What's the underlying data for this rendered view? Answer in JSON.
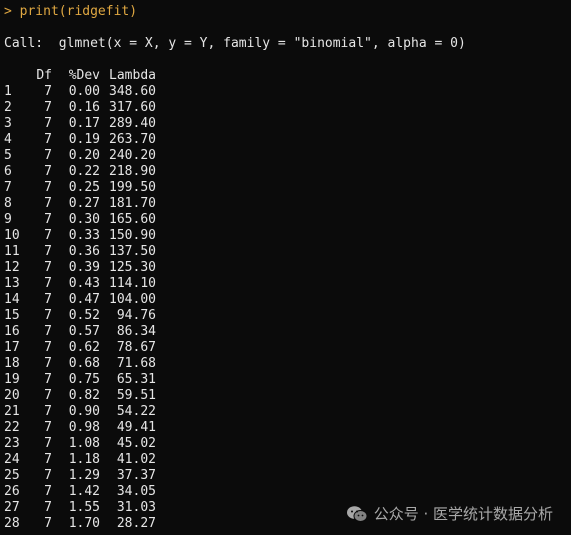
{
  "console": {
    "prompt_symbol": ">",
    "command": "print(ridgefit)",
    "call_line": "Call:  glmnet(x = X, y = Y, family = \"binomial\", alpha = 0)",
    "columns": [
      "",
      "Df",
      "%Dev",
      "Lambda"
    ],
    "rows": [
      {
        "idx": "1",
        "df": "7",
        "dev": "0.00",
        "lambda": "348.60"
      },
      {
        "idx": "2",
        "df": "7",
        "dev": "0.16",
        "lambda": "317.60"
      },
      {
        "idx": "3",
        "df": "7",
        "dev": "0.17",
        "lambda": "289.40"
      },
      {
        "idx": "4",
        "df": "7",
        "dev": "0.19",
        "lambda": "263.70"
      },
      {
        "idx": "5",
        "df": "7",
        "dev": "0.20",
        "lambda": "240.20"
      },
      {
        "idx": "6",
        "df": "7",
        "dev": "0.22",
        "lambda": "218.90"
      },
      {
        "idx": "7",
        "df": "7",
        "dev": "0.25",
        "lambda": "199.50"
      },
      {
        "idx": "8",
        "df": "7",
        "dev": "0.27",
        "lambda": "181.70"
      },
      {
        "idx": "9",
        "df": "7",
        "dev": "0.30",
        "lambda": "165.60"
      },
      {
        "idx": "10",
        "df": "7",
        "dev": "0.33",
        "lambda": "150.90"
      },
      {
        "idx": "11",
        "df": "7",
        "dev": "0.36",
        "lambda": "137.50"
      },
      {
        "idx": "12",
        "df": "7",
        "dev": "0.39",
        "lambda": "125.30"
      },
      {
        "idx": "13",
        "df": "7",
        "dev": "0.43",
        "lambda": "114.10"
      },
      {
        "idx": "14",
        "df": "7",
        "dev": "0.47",
        "lambda": "104.00"
      },
      {
        "idx": "15",
        "df": "7",
        "dev": "0.52",
        "lambda": "94.76"
      },
      {
        "idx": "16",
        "df": "7",
        "dev": "0.57",
        "lambda": "86.34"
      },
      {
        "idx": "17",
        "df": "7",
        "dev": "0.62",
        "lambda": "78.67"
      },
      {
        "idx": "18",
        "df": "7",
        "dev": "0.68",
        "lambda": "71.68"
      },
      {
        "idx": "19",
        "df": "7",
        "dev": "0.75",
        "lambda": "65.31"
      },
      {
        "idx": "20",
        "df": "7",
        "dev": "0.82",
        "lambda": "59.51"
      },
      {
        "idx": "21",
        "df": "7",
        "dev": "0.90",
        "lambda": "54.22"
      },
      {
        "idx": "22",
        "df": "7",
        "dev": "0.98",
        "lambda": "49.41"
      },
      {
        "idx": "23",
        "df": "7",
        "dev": "1.08",
        "lambda": "45.02"
      },
      {
        "idx": "24",
        "df": "7",
        "dev": "1.18",
        "lambda": "41.02"
      },
      {
        "idx": "25",
        "df": "7",
        "dev": "1.29",
        "lambda": "37.37"
      },
      {
        "idx": "26",
        "df": "7",
        "dev": "1.42",
        "lambda": "34.05"
      },
      {
        "idx": "27",
        "df": "7",
        "dev": "1.55",
        "lambda": "31.03"
      },
      {
        "idx": "28",
        "df": "7",
        "dev": "1.70",
        "lambda": "28.27"
      }
    ]
  },
  "watermark": {
    "icon": "wechat-icon",
    "text": "公众号 · 医学统计数据分析"
  },
  "colors": {
    "background": "#0b0b0b",
    "prompt": "#e0a842",
    "text": "#e6e6e6"
  }
}
